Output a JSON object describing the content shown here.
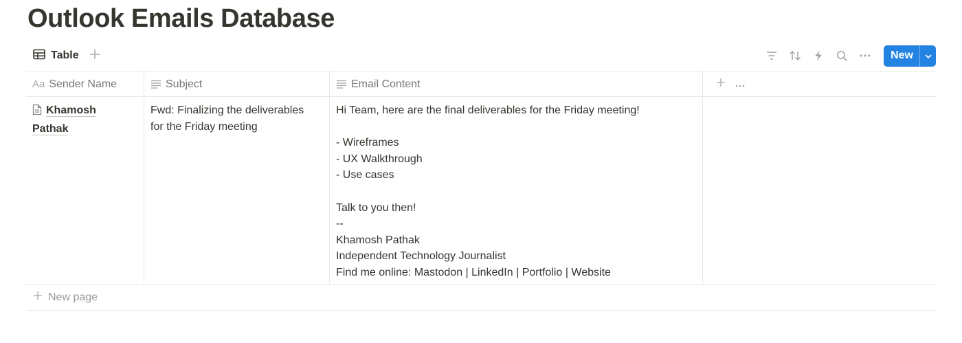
{
  "page": {
    "title": "Outlook Emails Database"
  },
  "view": {
    "tab_label": "Table",
    "tab_icon": "table-icon",
    "add_view": "+"
  },
  "toolbar": {
    "icons": [
      "filter-icon",
      "sort-icon",
      "automation-bolt-icon",
      "search-icon",
      "more-icon"
    ],
    "new_label": "New",
    "new_caret_icon": "chevron-down-icon",
    "accent": "#2383e2"
  },
  "table": {
    "columns": [
      {
        "label": "Sender Name",
        "type_icon": "Aa"
      },
      {
        "label": "Subject",
        "type_icon": "text-lines-icon"
      },
      {
        "label": "Email Content",
        "type_icon": "text-lines-icon"
      }
    ],
    "rows": [
      {
        "sender_first": "Khamosh",
        "sender_last": "Pathak",
        "subject_line1": "Fwd: Finalizing the deliverables",
        "subject_line2": "for the Friday meeting",
        "content": [
          "Hi Team, here are the final deliverables for the Friday meeting!",
          "",
          "- Wireframes",
          "- UX Walkthrough",
          "- Use cases",
          "",
          "Talk to you then!",
          "--",
          "Khamosh Pathak",
          "Independent Technology Journalist",
          "Find me online: Mastodon | LinkedIn | Portfolio | Website"
        ]
      }
    ],
    "new_page_label": "New page"
  }
}
